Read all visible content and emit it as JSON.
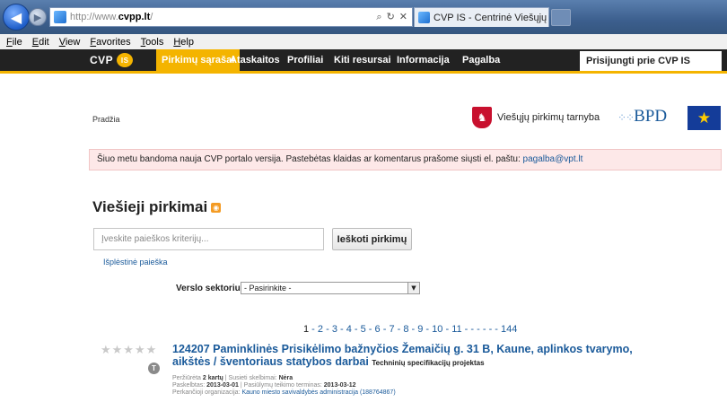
{
  "browser": {
    "url_prefix": "http://www.",
    "url_host": "cvpp.lt",
    "url_suffix": "/",
    "tab_title": "CVP IS - Centrinė Viešųjų pi...",
    "tab_close": "×",
    "menu": [
      "File",
      "Edit",
      "View",
      "Favorites",
      "Tools",
      "Help"
    ]
  },
  "site_nav": {
    "logo_text": "CVP",
    "logo_badge": "IS",
    "items": [
      "Pirkimų sąrašai",
      "Ataskaitos",
      "Profiliai",
      "Kiti resursai",
      "Informacija",
      "Pagalba"
    ],
    "login": "Prisijungti prie CVP IS"
  },
  "header": {
    "breadcrumb": "Pradžia",
    "vpt_label": "Viešųjų pirkimų tarnyba",
    "bpd_label": "BPD",
    "eu_stars": "★"
  },
  "notice": {
    "text": "Šiuo metu bandoma nauja CVP portalo versija. Pastebėtas klaidas ar komentarus prašome siųsti el. paštu:",
    "email": "pagalba@vpt.lt"
  },
  "main": {
    "title": "Viešieji pirkimai",
    "search_placeholder": "Įveskite paieškos kriterijų...",
    "search_button": "Ieškoti pirkimų",
    "advanced_link": "Išplėstinė paieška",
    "sector_label": "Verslo sektorius:",
    "sector_value": "- Pasirinkite -",
    "pager": [
      "1",
      "2",
      "3",
      "4",
      "5",
      "6",
      "7",
      "8",
      "9",
      "10",
      "11",
      "-",
      "-",
      "-",
      "144"
    ]
  },
  "result": {
    "stars": "★★★★★",
    "type_badge": "T",
    "title": "124207 Paminklinės Prisikėlimo bažnyčios Žemaičių g. 31 B, Kaune, aplinkos tvarymo, aikštės / šventoriaus statybos darbai",
    "subtype": "Techninių specifikacijų projektas",
    "viewed_label": "Peržiūrėta",
    "viewed_value": "2 kartų",
    "linked_label": "Susieti skelbimai:",
    "linked_value": "Nėra",
    "published_label": "Paskelbtas:",
    "published_value": "2013-03-01",
    "deadline_label": "Pasiūlymų teikimo terminas:",
    "deadline_value": "2013-03-12",
    "org_label": "Perkančioji organizacija:",
    "org_value": "Kauno miesto savivaldybės administracija (188764867)"
  }
}
